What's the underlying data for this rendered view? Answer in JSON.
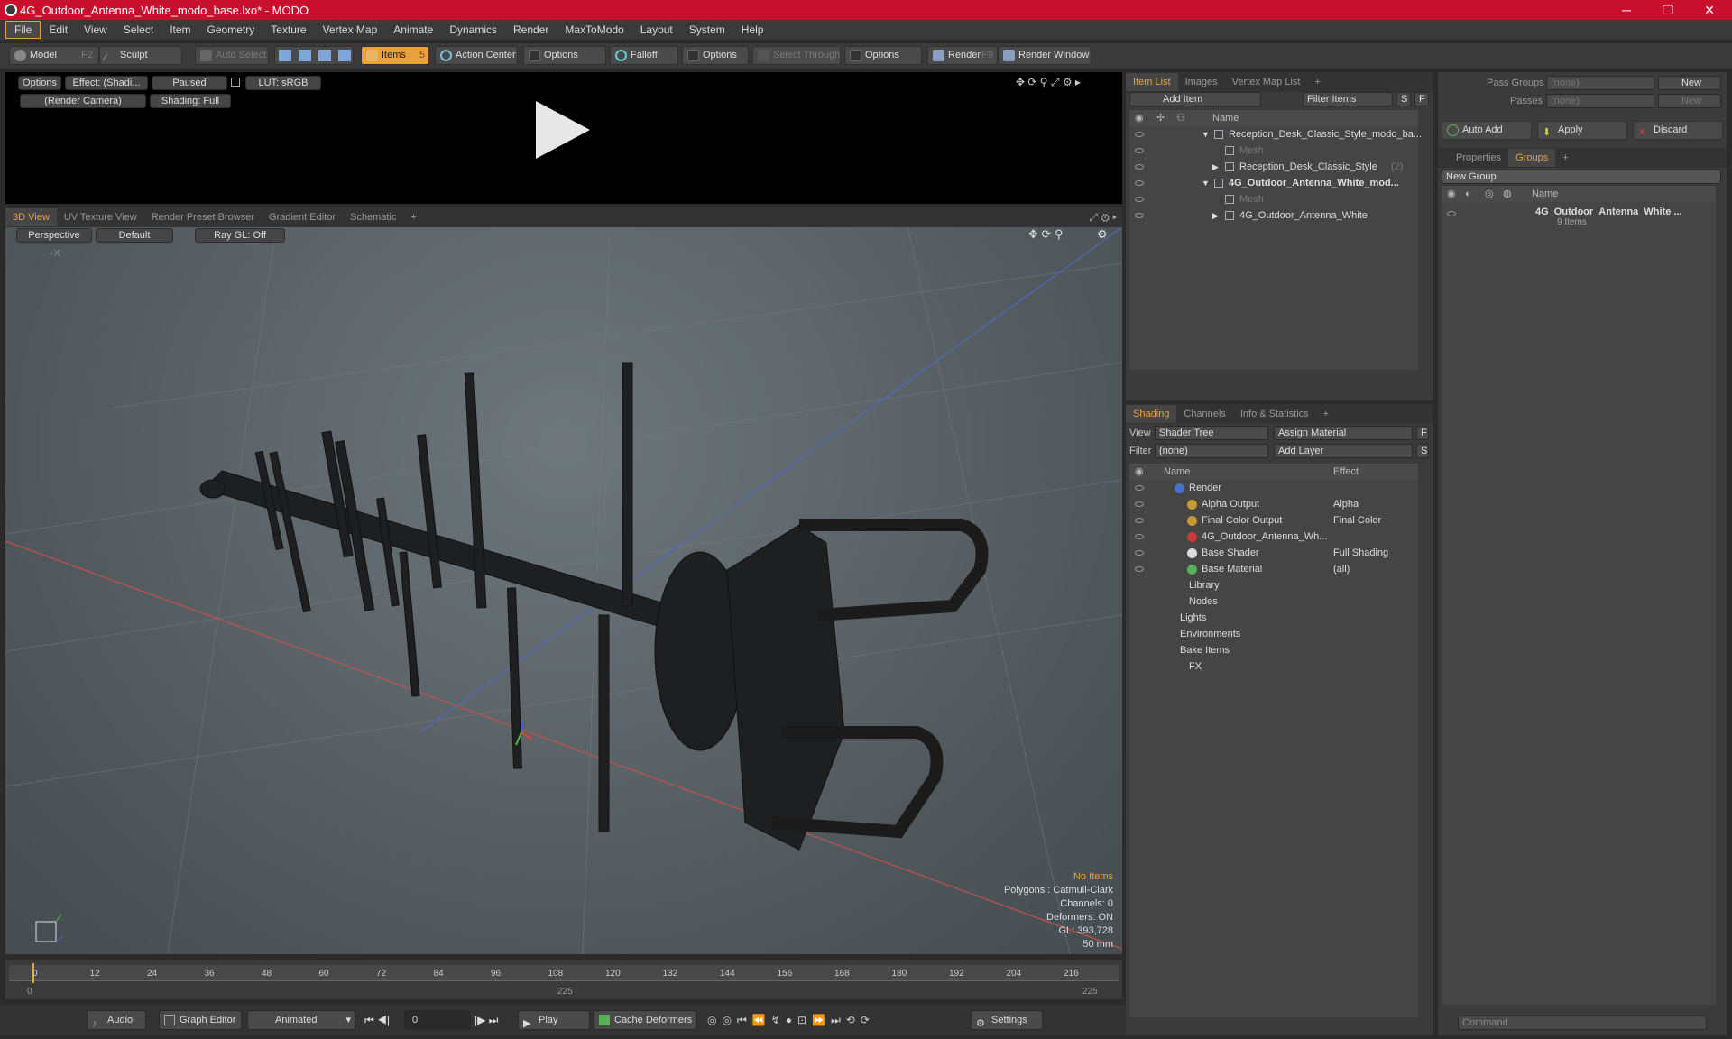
{
  "window": {
    "title": "4G_Outdoor_Antenna_White_modo_base.lxo* - MODO",
    "min": "─",
    "max": "❐",
    "close": "✕"
  },
  "menu": [
    "File",
    "Edit",
    "View",
    "Select",
    "Item",
    "Geometry",
    "Texture",
    "Vertex Map",
    "Animate",
    "Dynamics",
    "Render",
    "MaxToModo",
    "Layout",
    "System",
    "Help"
  ],
  "toolbar": {
    "model": "Model",
    "model_key": "F2",
    "sculpt": "Sculpt",
    "auto_select": "Auto Select",
    "items": "Items",
    "items_key": "5",
    "action_center": "Action Center",
    "options1": "Options",
    "falloff": "Falloff",
    "options2": "Options",
    "select_through": "Select Through",
    "options3": "Options",
    "render": "Render",
    "render_key": "F9",
    "render_window": "Render Window"
  },
  "preview": {
    "options": "Options",
    "effect": "Effect: (Shadi...",
    "paused": "Paused",
    "lut": "LUT: sRGB",
    "camera": "(Render Camera)",
    "shading": "Shading: Full"
  },
  "viewtabs": [
    "3D View",
    "UV Texture View",
    "Render Preset Browser",
    "Gradient Editor",
    "Schematic",
    "+"
  ],
  "viewport": {
    "perspective": "Perspective",
    "default": "Default",
    "raygl": "Ray GL: Off",
    "axis_label": "+X",
    "status": {
      "no_items": "No Items",
      "polygons": "Polygons : Catmull-Clark",
      "channels": "Channels: 0",
      "deformers": "Deformers: ON",
      "gl": "GL: 393,728",
      "scale": "50 mm"
    }
  },
  "timeline": {
    "ticks": [
      "0",
      "12",
      "24",
      "36",
      "48",
      "60",
      "72",
      "84",
      "96",
      "108",
      "120",
      "132",
      "144",
      "156",
      "168",
      "180",
      "192",
      "204",
      "216"
    ],
    "start": "0",
    "mid": "225",
    "end": "225"
  },
  "bottombar": {
    "audio": "Audio",
    "graph_editor": "Graph Editor",
    "animated": "Animated",
    "frame": "0",
    "play": "Play",
    "cache": "Cache Deformers",
    "settings": "Settings"
  },
  "itemlist": {
    "tabs": [
      "Item List",
      "Images",
      "Vertex Map List",
      "+"
    ],
    "add_item": "Add Item",
    "filter": "Filter Items",
    "s": "S",
    "f": "F",
    "name_header": "Name",
    "rows": [
      {
        "text": "Reception_Desk_Classic_Style_modo_ba...",
        "indent": 0,
        "expand": "▼",
        "bold": false,
        "dim": false
      },
      {
        "text": "Mesh",
        "indent": 1,
        "expand": "",
        "bold": false,
        "dim": true
      },
      {
        "text": "Reception_Desk_Classic_Style",
        "suffix": "(2)",
        "indent": 1,
        "expand": "▶",
        "bold": false,
        "dim": false
      },
      {
        "text": "4G_Outdoor_Antenna_White_mod...",
        "indent": 0,
        "expand": "▼",
        "bold": true,
        "dim": false
      },
      {
        "text": "Mesh",
        "indent": 1,
        "expand": "",
        "bold": false,
        "dim": true
      },
      {
        "text": "4G_Outdoor_Antenna_White",
        "indent": 1,
        "expand": "▶",
        "bold": false,
        "dim": false
      }
    ]
  },
  "shading": {
    "tabs": [
      "Shading",
      "Channels",
      "Info & Statistics",
      "+"
    ],
    "view_label": "View",
    "view_value": "Shader Tree",
    "assign": "Assign Material",
    "f": "F",
    "filter_label": "Filter",
    "filter_value": "(none)",
    "add_layer": "Add Layer",
    "s": "S",
    "name_header": "Name",
    "effect_header": "Effect",
    "rows": [
      {
        "name": "Render",
        "effect": "",
        "indent": 0,
        "color": "#4a6fd0"
      },
      {
        "name": "Alpha Output",
        "effect": "Alpha",
        "indent": 1,
        "color": "#c89a30"
      },
      {
        "name": "Final Color Output",
        "effect": "Final Color",
        "indent": 1,
        "color": "#c89a30"
      },
      {
        "name": "4G_Outdoor_Antenna_Wh...",
        "effect": "",
        "indent": 1,
        "color": "#c83a3a"
      },
      {
        "name": "Base Shader",
        "effect": "Full Shading",
        "indent": 1,
        "color": "#dddddd"
      },
      {
        "name": "Base Material",
        "effect": "(all)",
        "indent": 1,
        "color": "#5ab05a"
      },
      {
        "name": "Library",
        "effect": "",
        "indent": 2,
        "color": ""
      },
      {
        "name": "Nodes",
        "effect": "",
        "indent": 2,
        "color": ""
      },
      {
        "name": "Lights",
        "effect": "",
        "indent": 3,
        "color": ""
      },
      {
        "name": "Environments",
        "effect": "",
        "indent": 3,
        "color": ""
      },
      {
        "name": "Bake Items",
        "effect": "",
        "indent": 3,
        "color": ""
      },
      {
        "name": "FX",
        "effect": "",
        "indent": 2,
        "color": ""
      }
    ]
  },
  "groups": {
    "pass_groups": "Pass Groups",
    "passes": "Passes",
    "none1": "(none)",
    "none2": "(none)",
    "new1": "New",
    "new2": "New",
    "auto_add": "Auto Add",
    "apply": "Apply",
    "discard": "Discard",
    "tabs": [
      "Properties",
      "Groups",
      "+"
    ],
    "new_group": "New Group",
    "name_header": "Name",
    "group_name": "4G_Outdoor_Antenna_White ...",
    "group_count": "9 Items",
    "command": "Command"
  }
}
